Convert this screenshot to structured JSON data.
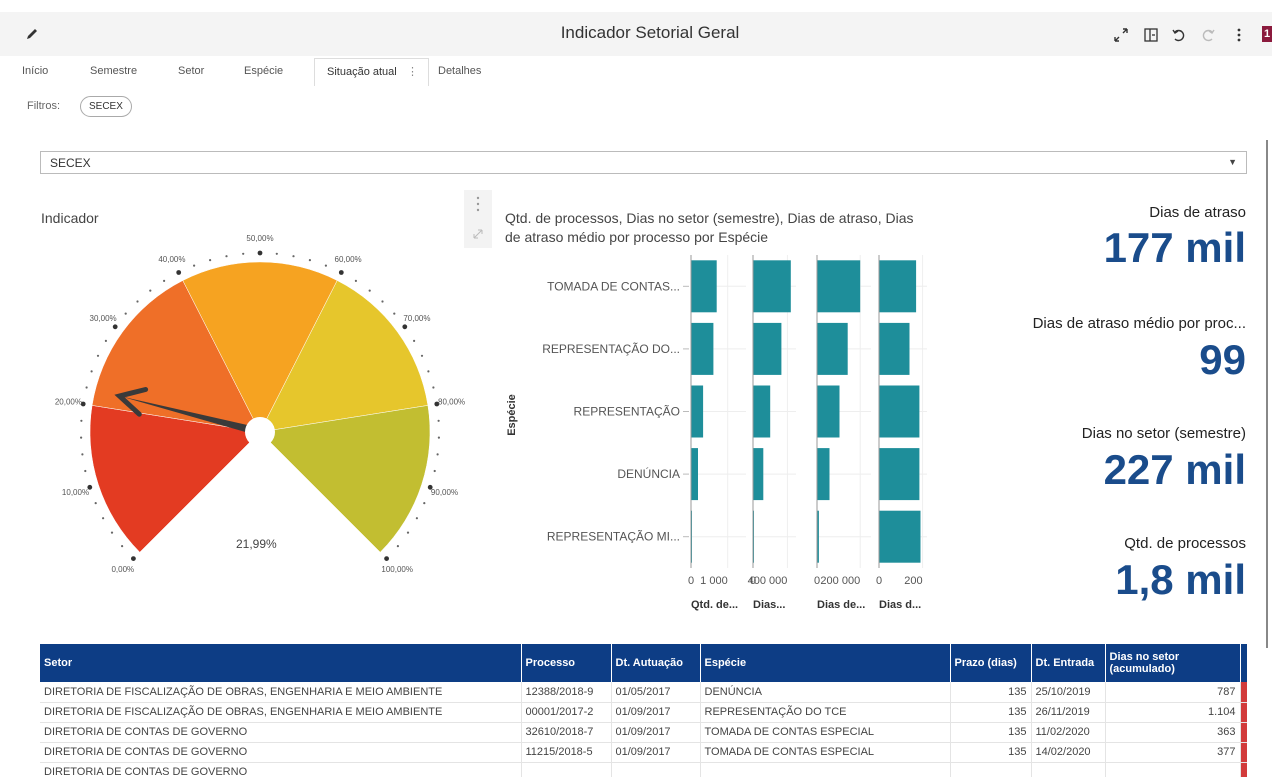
{
  "app": {
    "title": "Indicador Setorial Geral",
    "badge": "1"
  },
  "tabs": [
    {
      "label": "Início"
    },
    {
      "label": "Semestre"
    },
    {
      "label": "Setor"
    },
    {
      "label": "Espécie"
    },
    {
      "label": "Situação atual"
    },
    {
      "label": "Detalhes"
    }
  ],
  "filters": {
    "label": "Filtros:",
    "chip": "SECEX"
  },
  "dropdown": {
    "value": "SECEX"
  },
  "gauge": {
    "title": "Indicador",
    "value_label": "21,99%",
    "value": 0.2199,
    "ticks": [
      "0,00%",
      "10,00%",
      "20,00%",
      "30,00%",
      "40,00%",
      "50,00%",
      "60,00%",
      "70,00%",
      "80,00%",
      "90,00%",
      "100,00%"
    ],
    "segment_colors": [
      "#e33b22",
      "#ef6f28",
      "#f6a321",
      "#e6c62c",
      "#c2be31"
    ]
  },
  "chart_data": {
    "type": "bar",
    "orientation": "horizontal",
    "title": "Qtd. de processos, Dias no setor (semestre), Dias de atraso, Dias de atraso médio por processo por Espécie",
    "ylabel": "Espécie",
    "categories": [
      "TOMADA DE CONTAS...",
      "REPRESENTAÇÃO DO...",
      "REPRESENTAÇÃO",
      "DENÚNCIA",
      "REPRESENTAÇÃO MI..."
    ],
    "color": "#1e8e9a",
    "panels": [
      {
        "name": "Qtd. de...",
        "ticks": [
          "0",
          "1 000"
        ],
        "xlim": [
          0,
          1500
        ],
        "values": [
          700,
          610,
          330,
          190,
          20
        ]
      },
      {
        "name": "Dias...",
        "ticks": [
          "0",
          "400 000"
        ],
        "xlim": [
          0,
          500000
        ],
        "values": [
          440000,
          330000,
          200000,
          120000,
          10000
        ]
      },
      {
        "name": "Dias de...",
        "ticks": [
          "0",
          "200 000"
        ],
        "xlim": [
          0,
          250000
        ],
        "values": [
          200000,
          142000,
          104000,
          58000,
          9000
        ]
      },
      {
        "name": "Dias d...",
        "ticks": [
          "0",
          "200"
        ],
        "xlim": [
          0,
          220
        ],
        "values": [
          170,
          140,
          185,
          185,
          190
        ]
      }
    ]
  },
  "kpis": [
    {
      "label": "Dias de atraso",
      "value": "177 mil"
    },
    {
      "label": "Dias de atraso médio por proc...",
      "value": "99"
    },
    {
      "label": "Dias no setor (semestre)",
      "value": "227 mil"
    },
    {
      "label": "Qtd. de processos",
      "value": "1,8 mil"
    }
  ],
  "table": {
    "columns": [
      "Setor",
      "Processo",
      "Dt. Autuação",
      "Espécie",
      "Prazo (dias)",
      "Dt. Entrada",
      "Dias no setor (acumulado)"
    ],
    "rows": [
      [
        "DIRETORIA DE FISCALIZAÇÃO DE OBRAS, ENGENHARIA E MEIO AMBIENTE",
        "12388/2018-9",
        "01/05/2017",
        "DENÚNCIA",
        "135",
        "25/10/2019",
        "787"
      ],
      [
        "DIRETORIA DE FISCALIZAÇÃO DE OBRAS, ENGENHARIA E MEIO AMBIENTE",
        "00001/2017-2",
        "01/09/2017",
        "REPRESENTAÇÃO DO TCE",
        "135",
        "26/11/2019",
        "1.104"
      ],
      [
        "DIRETORIA DE CONTAS DE GOVERNO",
        "32610/2018-7",
        "01/09/2017",
        "TOMADA DE CONTAS ESPECIAL",
        "135",
        "11/02/2020",
        "363"
      ],
      [
        "DIRETORIA DE CONTAS DE GOVERNO",
        "11215/2018-5",
        "01/09/2017",
        "TOMADA DE CONTAS ESPECIAL",
        "135",
        "14/02/2020",
        "377"
      ],
      [
        "DIRETORIA DE CONTAS DE GOVERNO",
        "",
        "",
        "",
        "",
        "",
        ""
      ]
    ]
  }
}
